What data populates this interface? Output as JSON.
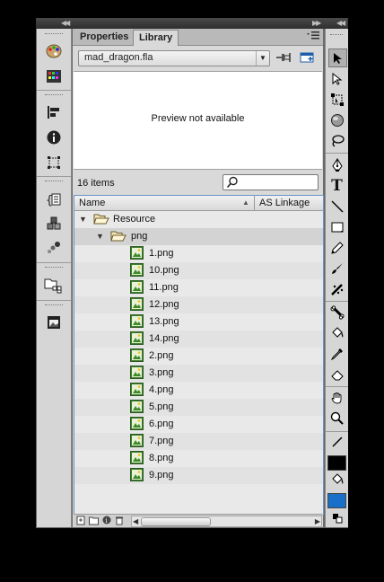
{
  "tabs": [
    {
      "label": "Properties",
      "active": false
    },
    {
      "label": "Library",
      "active": true
    }
  ],
  "document_select": {
    "value": "mad_dragon.fla"
  },
  "preview": {
    "text": "Preview not available"
  },
  "item_count": "16 items",
  "search": {
    "placeholder": "",
    "value": ""
  },
  "columns": {
    "name": "Name",
    "linkage": "AS Linkage"
  },
  "tree": {
    "root": {
      "label": "Resource",
      "icon": "folder-open-icon",
      "expanded": true
    },
    "sub": {
      "label": "png",
      "icon": "folder-open-icon",
      "expanded": true
    },
    "files": [
      "1.png",
      "10.png",
      "11.png",
      "12.png",
      "13.png",
      "14.png",
      "2.png",
      "3.png",
      "4.png",
      "5.png",
      "6.png",
      "7.png",
      "8.png",
      "9.png"
    ],
    "file_icon": "bitmap-icon"
  },
  "colors": {
    "panel_bg": "#d9d9d9",
    "list_border": "#6b93c4",
    "stroke_color": "#000000",
    "fill_color": "#1a6fc9"
  },
  "left_icons": [
    "color-palette-icon",
    "swatches-icon",
    "align-icon",
    "info-icon",
    "transform-icon",
    "code-snippets-icon",
    "components-icon",
    "motion-presets-icon",
    "project-icon",
    "library-icon"
  ],
  "tools": [
    "selection-tool-icon",
    "subselection-tool-icon",
    "free-transform-tool-icon",
    "3d-rotation-tool-icon",
    "lasso-tool-icon",
    "pen-tool-icon",
    "text-tool-icon",
    "line-tool-icon",
    "rectangle-tool-icon",
    "pencil-tool-icon",
    "brush-tool-icon",
    "deco-tool-icon",
    "bone-tool-icon",
    "paint-bucket-tool-icon",
    "eyedropper-tool-icon",
    "eraser-tool-icon",
    "hand-tool-icon",
    "zoom-tool-icon",
    "stroke-color-icon",
    "fill-color-icon",
    "swap-colors-icon"
  ]
}
